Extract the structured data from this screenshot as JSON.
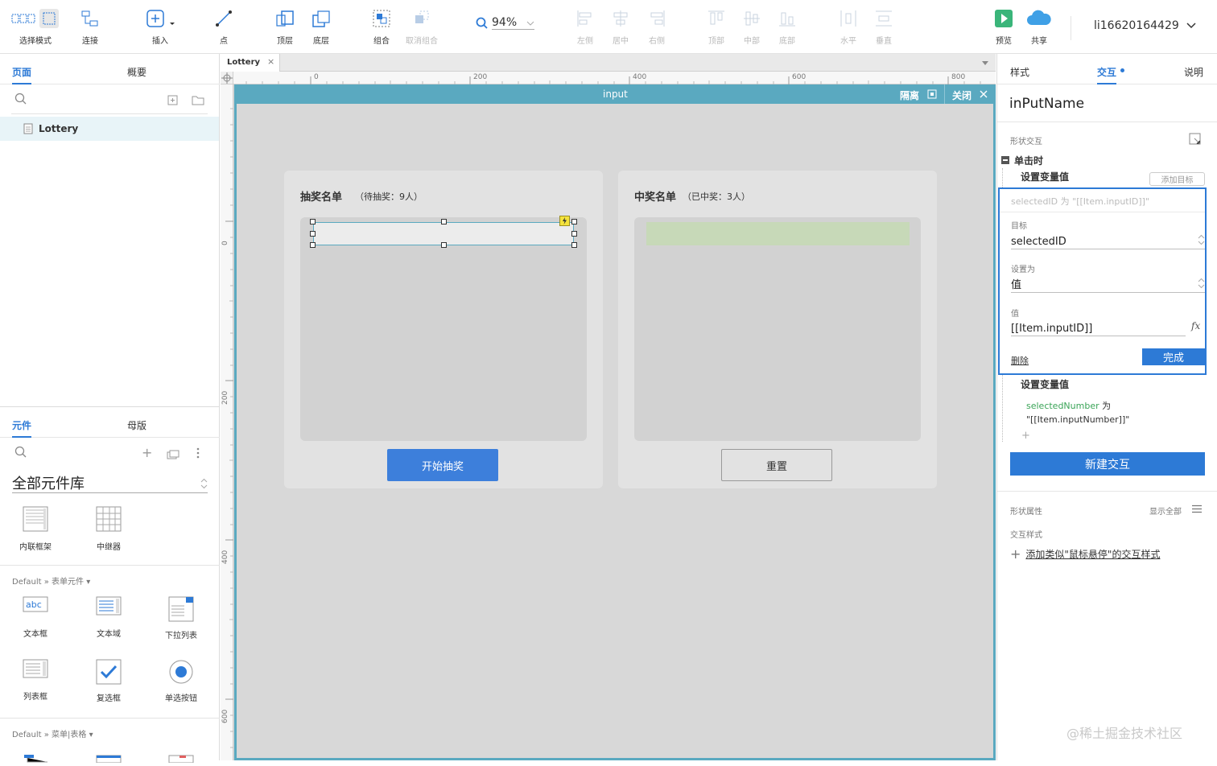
{
  "toolbar": {
    "select_mode": "选择模式",
    "connect": "连接",
    "insert": "插入",
    "point": "点",
    "top_layer": "顶层",
    "bottom_layer": "底层",
    "group": "组合",
    "ungroup": "取消组合",
    "zoom": "94%",
    "align_left": "左侧",
    "align_center": "居中",
    "align_right": "右侧",
    "align_top": "顶部",
    "align_middle": "中部",
    "align_bottom": "底部",
    "dist_horizontal": "水平",
    "dist_vertical": "垂直",
    "preview": "预览",
    "share": "共享",
    "user": "li16620164429"
  },
  "left": {
    "tabs": [
      "页面",
      "概要"
    ],
    "pages": [
      "Lottery"
    ],
    "lib_tabs": [
      "元件",
      "母版"
    ],
    "library_select": "全部元件库",
    "widgets_top": [
      "内联框架",
      "中继器"
    ],
    "section_form": "Default » 表单元件",
    "form_widgets": [
      "文本框",
      "文本域",
      "下拉列表",
      "列表框",
      "复选框",
      "单选按钮"
    ],
    "section_menu": "Default » 菜单|表格"
  },
  "canvas": {
    "doc_tab": "Lottery",
    "ruler_h": [
      "0",
      "200",
      "400",
      "600",
      "800"
    ],
    "ruler_v": [
      "0",
      "200",
      "400",
      "600"
    ],
    "frame_title": "input",
    "isolate": "隔离",
    "close": "关闭",
    "left_card_title": "抽奖名单",
    "left_card_sub": "（待抽奖：9人）",
    "right_card_title": "中奖名单",
    "right_card_sub": "（已中奖：3人）",
    "start_button": "开始抽奖",
    "reset_button": "重置"
  },
  "right": {
    "tabs": [
      "样式",
      "交互",
      "说明"
    ],
    "widget_name": "inPutName",
    "shape_interaction": "形状交互",
    "event": "单击时",
    "action1": "设置变量值",
    "add_target": "添加目标",
    "summary": "selectedID 为 \"[[Item.inputID]]\"",
    "target_label": "目标",
    "target_value": "selectedID",
    "setas_label": "设置为",
    "setas_value": "值",
    "value_label": "值",
    "value_value": "[[Item.inputID]]",
    "delete": "删除",
    "done": "完成",
    "action2": "设置变量值",
    "action2_var": "selectedNumber",
    "action2_as": "为",
    "action2_val": "\"[[Item.inputNumber]]\"",
    "new_interaction": "新建交互",
    "shape_props": "形状属性",
    "show_all": "显示全部",
    "interaction_style": "交互样式",
    "add_style": "添加类似\"鼠标悬停\"的交互样式"
  },
  "watermark": "@稀土掘金技术社区",
  "colors": {
    "accent": "#2d7ad6",
    "frame": "#5aa9c0",
    "start_button": "#3d7fdb",
    "green_bar": "#c7d9b8"
  }
}
